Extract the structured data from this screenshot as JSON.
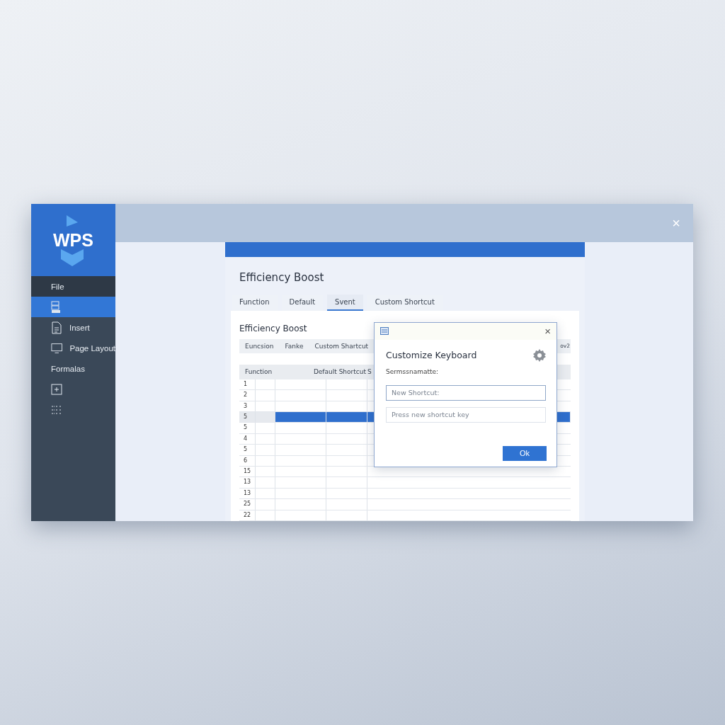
{
  "sidebar": {
    "logo": "WPS",
    "items": [
      {
        "kind": "header",
        "label": "File",
        "selected": false
      },
      {
        "kind": "icon",
        "selected": true
      },
      {
        "kind": "icon_text",
        "label": "Insert",
        "selected": false
      },
      {
        "kind": "icon_text",
        "label": "Page Layout",
        "selected": false
      },
      {
        "kind": "text",
        "label": "Formalas",
        "selected": false
      },
      {
        "kind": "icon",
        "selected": false
      },
      {
        "kind": "icon",
        "selected": false
      }
    ]
  },
  "window": {
    "close": "×"
  },
  "panel": {
    "title": "Efficiency Boost",
    "tabs": [
      {
        "label": "Function",
        "selected": false
      },
      {
        "label": "Default",
        "selected": false
      },
      {
        "label": "Svent",
        "selected": true
      },
      {
        "label": "Custom Shortcut",
        "selected": false
      }
    ]
  },
  "card": {
    "title": "Efficiency Boost",
    "subtabs": [
      "Euncsion",
      "Fanke",
      "Custom Shartcut"
    ],
    "subtab_tail": "ov2",
    "table": {
      "columns": [
        "Function",
        "Default Shortcut",
        "S"
      ],
      "rows": [
        {
          "number": "1",
          "selected": false
        },
        {
          "number": "2",
          "selected": false
        },
        {
          "number": "3",
          "selected": false
        },
        {
          "number": "5",
          "selected": true
        },
        {
          "number": "5",
          "selected": false
        },
        {
          "number": "4",
          "selected": false
        },
        {
          "number": "5",
          "selected": false
        },
        {
          "number": "6",
          "selected": false
        },
        {
          "number": "15",
          "selected": false
        },
        {
          "number": "13",
          "selected": false
        },
        {
          "number": "13",
          "selected": false
        },
        {
          "number": "25",
          "selected": false
        },
        {
          "number": "22",
          "selected": false
        }
      ]
    }
  },
  "dialog": {
    "close": "×",
    "title": "Customize Keyboard",
    "label": "Sermssnamatte:",
    "fields": [
      {
        "placeholder": "New Shortcut:",
        "focused": true
      },
      {
        "placeholder": "Press new shortcut key",
        "focused": false
      }
    ],
    "button": "Ok"
  }
}
